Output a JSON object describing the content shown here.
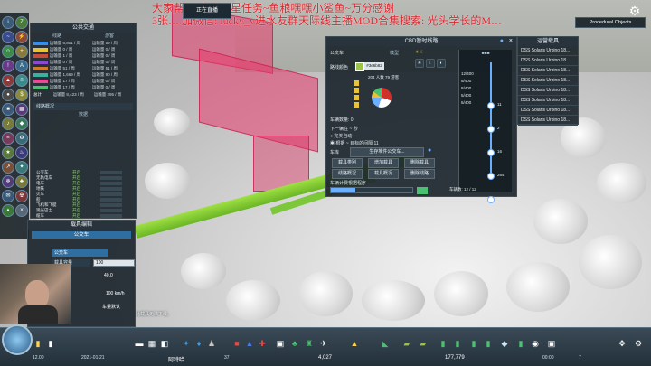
{
  "overlay": {
    "line1": "大家帮… 完成福星任务~鱼粮嘿嘿小鲨鱼~万分感谢",
    "line2": "3张… 加微信: lucky_v进水友群天际线主播MOD合集搜索: 光头学长的M…"
  },
  "top_tag": {
    "label": "正在直播"
  },
  "procedural_objects": "Procedural Objects",
  "public_transport": {
    "title": "公共交通",
    "col1": "线路",
    "col2": "游客",
    "rows": [
      {
        "color": "#3a8ee8",
        "c1": "运输量 6,801 / 周",
        "c2": "运输量 59 / 周"
      },
      {
        "color": "#e8c23a",
        "c1": "运输量 0 / 周",
        "c2": "运输量 0 / 周"
      },
      {
        "color": "#c84a3a",
        "c1": "运输量 1 / 周",
        "c2": "运输量 0 / 周"
      },
      {
        "color": "#8a4ad0",
        "c1": "运输量 0 / 周",
        "c2": "运输量 0 / 周"
      },
      {
        "color": "#d07a2a",
        "c1": "运输量 51 / 周",
        "c2": "运输量 51 / 周"
      },
      {
        "color": "#3ab0a0",
        "c1": "运输量 1,669 / 周",
        "c2": "运输量 90 / 周"
      },
      {
        "color": "#e84a9a",
        "c1": "运输量 17 / 周",
        "c2": "运输量 0 / 周"
      },
      {
        "color": "#4ac070",
        "c1": "运输量 17 / 周",
        "c2": "运输量 0 / 周"
      }
    ],
    "total_label": "总计",
    "total_c1": "运输量 8,423 / 周",
    "total_c2": "运输量 295 / 周",
    "section2": "线路概况",
    "header2": "数据",
    "types": [
      "公交车",
      "无轨电车",
      "电车",
      "地铁",
      "火车",
      "船",
      "飞机和飞艇",
      "观光巴士",
      "缆车",
      "其他"
    ],
    "values": [
      "开启",
      "开启",
      "开启",
      "开启",
      "开启",
      "开启",
      "开启",
      "开启",
      "开启",
      "开启"
    ]
  },
  "vehicle_edit": {
    "title": "载具编辑",
    "subtitle": "公交车",
    "type_label": "公交车",
    "field_label": "载具容量",
    "field_value": "100",
    "cost_value": "40.0",
    "speed_value": "100 km/h",
    "reset_label": "车量默认"
  },
  "webcam_caption": "此载具无法下线。",
  "cbd_panel": {
    "title": "CBD暂时线路",
    "type": "公交车",
    "line_color_label": "路线颜色",
    "color_hex": "#3e6b82",
    "time_label": "模型",
    "budget_label": "车辆数",
    "vehicle_count_label": "车辆数量: 0",
    "timer_label": "下一辆在 ~ 秒",
    "radio1": "完美自动",
    "radio2": "根据 ~ 目标的间隔 11",
    "stations_label": "车库",
    "default_btn": "生存堆件公交车...",
    "buttons": [
      "载具类别",
      "增加载具",
      "删除载具",
      "线路概况",
      "载具概况",
      "删除线路"
    ],
    "bottom_label": "车辆计费根据程序",
    "pie_label": "204 人数 79 游客",
    "stops": [
      "11",
      "2",
      "16",
      "264",
      "17"
    ],
    "capacity_labels": [
      "12/400",
      "6/400",
      "8/400",
      "5/400",
      "6/400"
    ],
    "footer": "车辆数: 12 / 12"
  },
  "vehicles_panel": {
    "title": "运营载具",
    "items": [
      "DSS Solaris Urbino 18...",
      "DSS Solaris Urbino 18...",
      "DSS Solaris Urbino 18...",
      "DSS Solaris Urbino 18...",
      "DSS Solaris Urbino 18...",
      "DSS Solaris Urbino 18...",
      "DSS Solaris Urbino 18...",
      "DSS Solaris Urbino 18..."
    ]
  },
  "bottom": {
    "date": "2021-01-21",
    "city": "阿特哈",
    "population": "4,027",
    "money": "177,779",
    "stat1": "12.00",
    "stat2": "37",
    "stat3": "00:00",
    "stat4": "7"
  }
}
